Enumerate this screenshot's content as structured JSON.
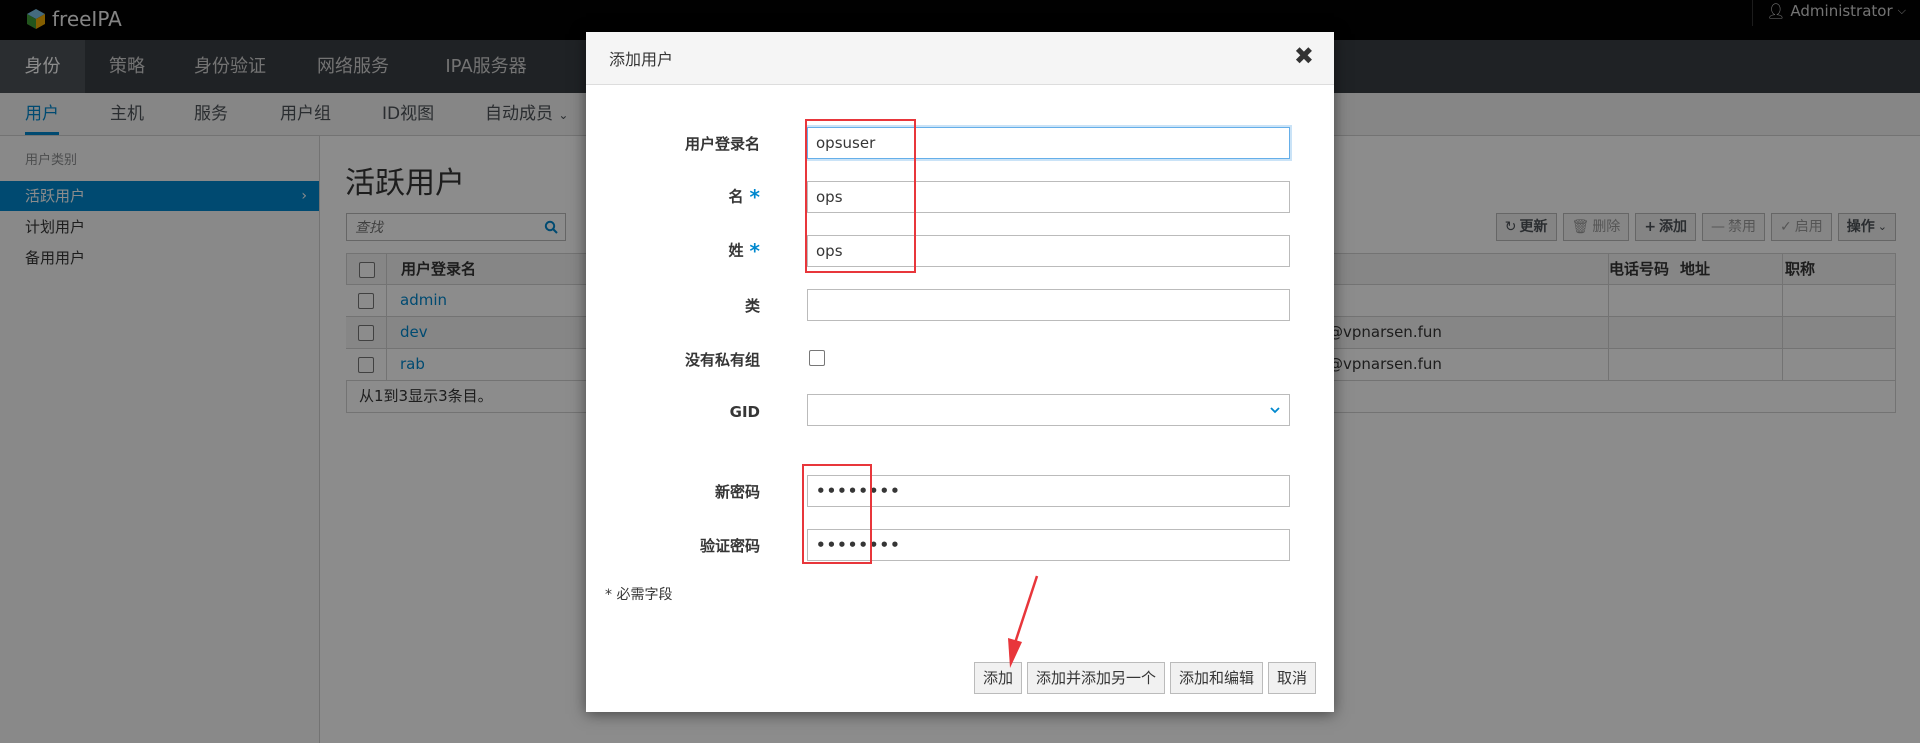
{
  "app": {
    "logo_text": "freeIPA",
    "user_label": "Administrator"
  },
  "main_nav": [
    {
      "label": "身份",
      "active": true
    },
    {
      "label": "策略"
    },
    {
      "label": "身份验证"
    },
    {
      "label": "网络服务"
    },
    {
      "label": "IPA服务器"
    }
  ],
  "sub_nav": [
    {
      "label": "用户",
      "active": true
    },
    {
      "label": "主机"
    },
    {
      "label": "服务"
    },
    {
      "label": "用户组"
    },
    {
      "label": "ID视图"
    },
    {
      "label": "自动成员"
    }
  ],
  "sidebar": {
    "title": "用户类别",
    "items": [
      {
        "label": "活跃用户",
        "active": true
      },
      {
        "label": "计划用户"
      },
      {
        "label": "备用用户"
      }
    ]
  },
  "content": {
    "title": "活跃用户",
    "search_placeholder": "查找",
    "toolbar": {
      "refresh": "更新",
      "delete": "删除",
      "add": "添加",
      "disable": "禁用",
      "enable": "启用",
      "actions": "操作"
    },
    "table": {
      "headers": {
        "login": "用户登录名",
        "email": "地址",
        "phone": "电话号码",
        "title": "职称"
      },
      "rows": [
        {
          "login": "admin",
          "email": "",
          "phone": "",
          "title": ""
        },
        {
          "login": "dev",
          "email": "@vpnarsen.fun",
          "phone": "",
          "title": ""
        },
        {
          "login": "rab",
          "email": "@vpnarsen.fun",
          "phone": "",
          "title": ""
        }
      ],
      "footer": "从1到3显示3条目。"
    }
  },
  "modal": {
    "title": "添加用户",
    "fields": {
      "login_label": "用户登录名",
      "login_value": "opsuser",
      "first_label": "名",
      "first_value": "ops",
      "last_label": "姓",
      "last_value": "ops",
      "class_label": "类",
      "class_value": "",
      "noprivate_label": "没有私有组",
      "gid_label": "GID",
      "newpw_label": "新密码",
      "newpw_value": "••••••••",
      "verifypw_label": "验证密码",
      "verifypw_value": "••••••••",
      "required_marker": "*"
    },
    "required_note": "* 必需字段",
    "buttons": {
      "add": "添加",
      "add_another": "添加并添加另一个",
      "add_edit": "添加和编辑",
      "cancel": "取消"
    }
  },
  "colors": {
    "accent": "#0088ce",
    "annotation": "#e8363b",
    "nav_bg": "#393f44",
    "topbar_bg": "#030303"
  }
}
